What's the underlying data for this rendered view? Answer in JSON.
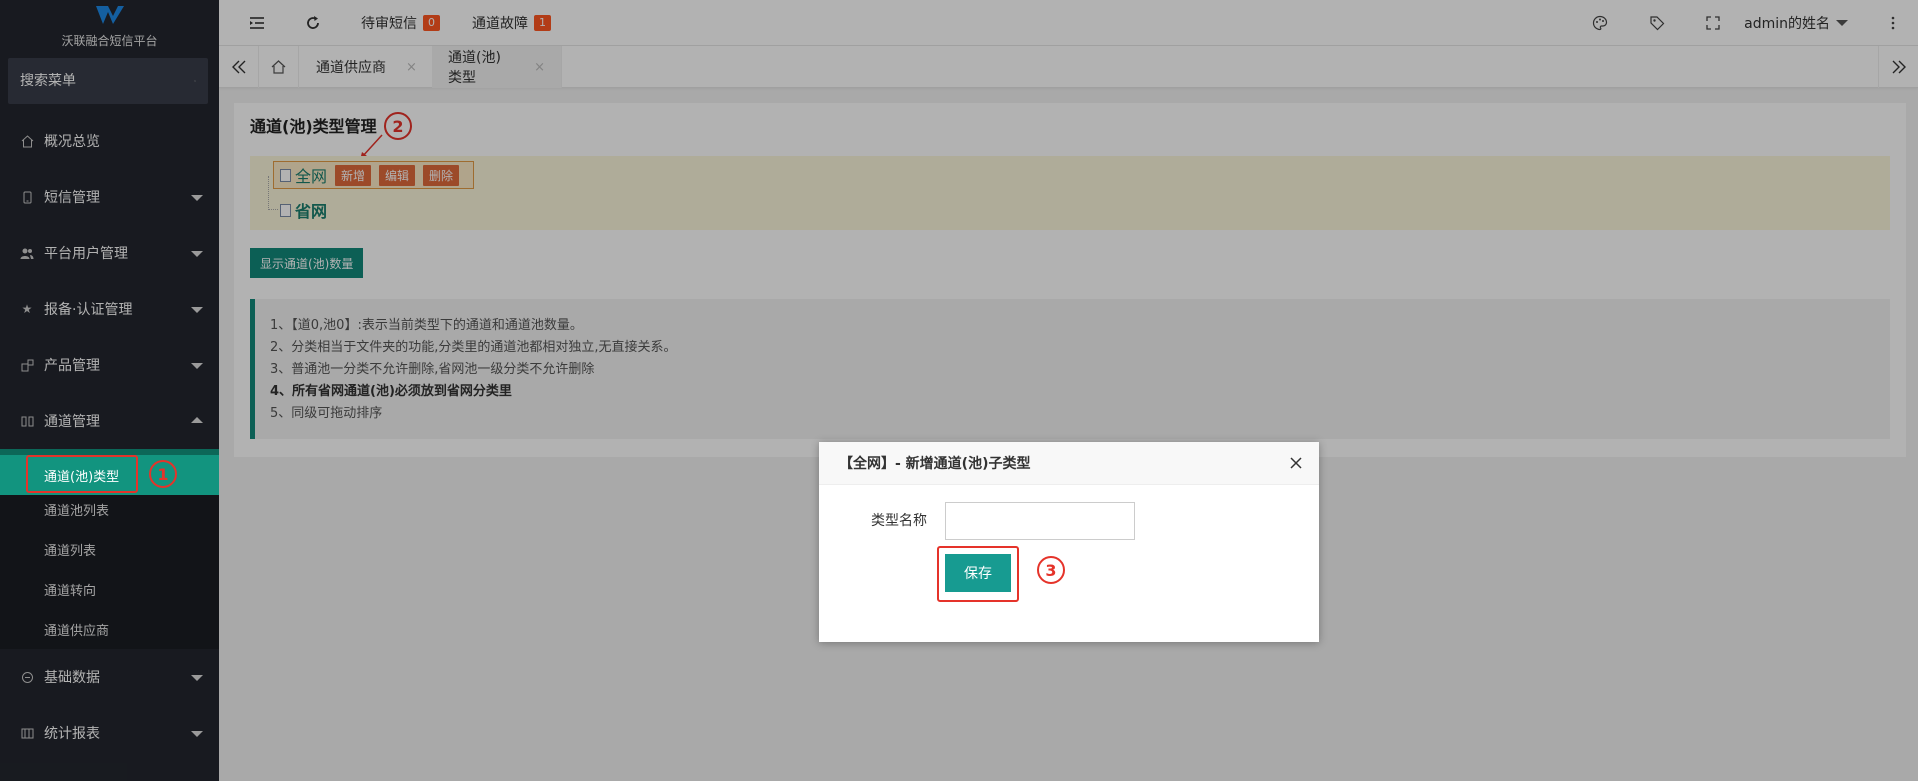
{
  "sidebar": {
    "logo_text": "沃联融合短信平台",
    "search_placeholder": "搜索菜单",
    "menu": [
      {
        "label": "概况总览",
        "icon": "home-icon"
      },
      {
        "label": "短信管理",
        "icon": "phone-icon"
      },
      {
        "label": "平台用户管理",
        "icon": "users-icon"
      },
      {
        "label": "报备·认证管理",
        "icon": "star-icon"
      },
      {
        "label": "产品管理",
        "icon": "product-icon"
      },
      {
        "label": "通道管理",
        "icon": "channel-icon"
      },
      {
        "label": "基础数据",
        "icon": "data-icon"
      },
      {
        "label": "统计报表",
        "icon": "report-icon"
      }
    ],
    "submenu": [
      {
        "label": "通道(池)类型"
      },
      {
        "label": "通道池列表"
      },
      {
        "label": "通道列表"
      },
      {
        "label": "通道转向"
      },
      {
        "label": "通道供应商"
      }
    ],
    "annotation_1": "1"
  },
  "header": {
    "pending_sms_label": "待审短信",
    "pending_sms_count": "0",
    "channel_fault_label": "通道故障",
    "channel_fault_count": "1",
    "user_name": "admin的姓名"
  },
  "tabs": [
    {
      "label": "通道供应商",
      "close": "×"
    },
    {
      "label": "通道(池)类型",
      "close": "×"
    }
  ],
  "main": {
    "title": "通道(池)类型管理",
    "annotation_2": "2",
    "tree": {
      "node1": "全网",
      "node1_actions": [
        "新增",
        "编辑",
        "删除"
      ],
      "node2": "省网"
    },
    "show_count_button": "显示通道(池)数量",
    "notes": [
      "1、【道0,池0】:表示当前类型下的通道和通道池数量。",
      "2、分类相当于文件夹的功能,分类里的通道池都相对独立,无直接关系。",
      "3、普通池一分类不允许删除,省网池一级分类不允许删除",
      "4、所有省网通道(池)必须放到省网分类里",
      "5、同级可拖动排序"
    ]
  },
  "dialog": {
    "title": "【全网】- 新增通道(池)子类型",
    "field_label": "类型名称",
    "field_value": "",
    "save_label": "保存",
    "annotation_3": "3"
  },
  "colors": {
    "sidebar_bg": "#23262e",
    "active_green": "#12947f",
    "badge_orange": "#ff5722",
    "annotation_red": "#e5332a"
  }
}
